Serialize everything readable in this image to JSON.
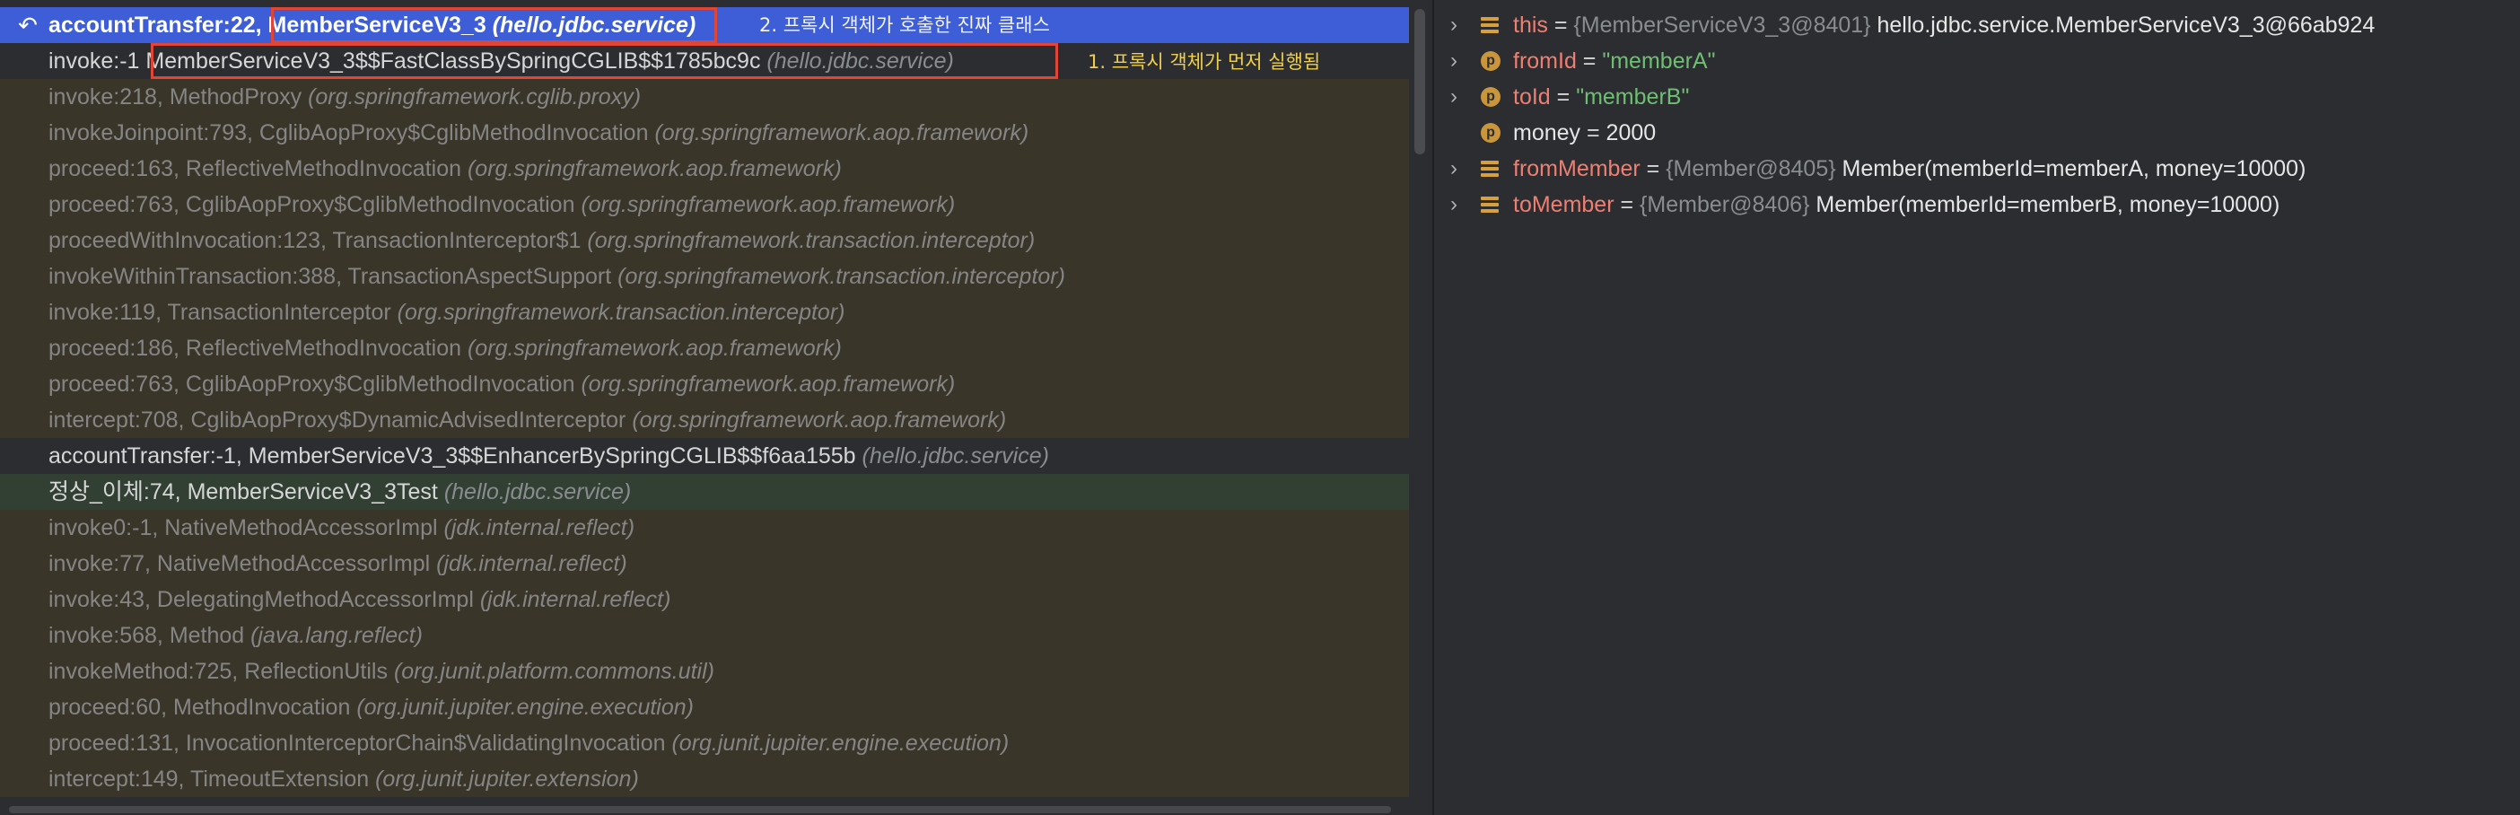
{
  "frames": [
    {
      "method": "accountTransfer:22, ",
      "cls": "MemberServiceV3_3",
      "pkg": "(hello.jdbc.service)",
      "kind": "selected"
    },
    {
      "method": "invoke:-1 ",
      "cls": "MemberServiceV3_3$$FastClassBySpringCGLIB$$1785bc9c",
      "pkg": "(hello.jdbc.service)",
      "kind": "user"
    },
    {
      "method": "invoke:218, ",
      "cls": "MethodProxy",
      "pkg": "(org.springframework.cglib.proxy)",
      "kind": "lib"
    },
    {
      "method": "invokeJoinpoint:793, ",
      "cls": "CglibAopProxy$CglibMethodInvocation",
      "pkg": "(org.springframework.aop.framework)",
      "kind": "lib"
    },
    {
      "method": "proceed:163, ",
      "cls": "ReflectiveMethodInvocation",
      "pkg": "(org.springframework.aop.framework)",
      "kind": "lib"
    },
    {
      "method": "proceed:763, ",
      "cls": "CglibAopProxy$CglibMethodInvocation",
      "pkg": "(org.springframework.aop.framework)",
      "kind": "lib"
    },
    {
      "method": "proceedWithInvocation:123, ",
      "cls": "TransactionInterceptor$1",
      "pkg": "(org.springframework.transaction.interceptor)",
      "kind": "lib"
    },
    {
      "method": "invokeWithinTransaction:388, ",
      "cls": "TransactionAspectSupport",
      "pkg": "(org.springframework.transaction.interceptor)",
      "kind": "lib"
    },
    {
      "method": "invoke:119, ",
      "cls": "TransactionInterceptor",
      "pkg": "(org.springframework.transaction.interceptor)",
      "kind": "lib"
    },
    {
      "method": "proceed:186, ",
      "cls": "ReflectiveMethodInvocation",
      "pkg": "(org.springframework.aop.framework)",
      "kind": "lib"
    },
    {
      "method": "proceed:763, ",
      "cls": "CglibAopProxy$CglibMethodInvocation",
      "pkg": "(org.springframework.aop.framework)",
      "kind": "lib"
    },
    {
      "method": "intercept:708, ",
      "cls": "CglibAopProxy$DynamicAdvisedInterceptor",
      "pkg": "(org.springframework.aop.framework)",
      "kind": "lib"
    },
    {
      "method": "accountTransfer:-1, ",
      "cls": "MemberServiceV3_3$$EnhancerBySpringCGLIB$$f6aa155b",
      "pkg": "(hello.jdbc.service)",
      "kind": "user"
    },
    {
      "method": "정상_이체:74, ",
      "cls": "MemberServiceV3_3Test",
      "pkg": "(hello.jdbc.service)",
      "kind": "test"
    },
    {
      "method": "invoke0:-1, ",
      "cls": "NativeMethodAccessorImpl",
      "pkg": "(jdk.internal.reflect)",
      "kind": "lib"
    },
    {
      "method": "invoke:77, ",
      "cls": "NativeMethodAccessorImpl",
      "pkg": "(jdk.internal.reflect)",
      "kind": "lib"
    },
    {
      "method": "invoke:43, ",
      "cls": "DelegatingMethodAccessorImpl",
      "pkg": "(jdk.internal.reflect)",
      "kind": "lib"
    },
    {
      "method": "invoke:568, ",
      "cls": "Method",
      "pkg": "(java.lang.reflect)",
      "kind": "lib"
    },
    {
      "method": "invokeMethod:725, ",
      "cls": "ReflectionUtils",
      "pkg": "(org.junit.platform.commons.util)",
      "kind": "lib"
    },
    {
      "method": "proceed:60, ",
      "cls": "MethodInvocation",
      "pkg": "(org.junit.jupiter.engine.execution)",
      "kind": "lib"
    },
    {
      "method": "proceed:131, ",
      "cls": "InvocationInterceptorChain$ValidatingInvocation",
      "pkg": "(org.junit.jupiter.engine.execution)",
      "kind": "lib"
    },
    {
      "method": "intercept:149, ",
      "cls": "TimeoutExtension",
      "pkg": "(org.junit.jupiter.extension)",
      "kind": "lib"
    }
  ],
  "annotations": {
    "real_class": "2. 프록시 객체가 호출한 진짜 클래스",
    "proxy_first": "1. 프록시 객체가 먼저 실행됨"
  },
  "variables": [
    {
      "name": "this",
      "ref": "{MemberServiceV3_3@8401}",
      "value": "hello.jdbc.service.MemberServiceV3_3@66ab924",
      "icon": "field-icon",
      "expandable": true
    },
    {
      "name": "fromId",
      "str": "\"memberA\"",
      "icon": "parameter-icon",
      "expandable": true
    },
    {
      "name": "toId",
      "str": "\"memberB\"",
      "icon": "parameter-icon",
      "expandable": true
    },
    {
      "name": "money",
      "num": "2000",
      "icon": "parameter-icon",
      "expandable": false
    },
    {
      "name": "fromMember",
      "ref": "{Member@8405}",
      "value": "Member(memberId=memberA, money=10000)",
      "icon": "field-icon",
      "expandable": true
    },
    {
      "name": "toMember",
      "ref": "{Member@8406}",
      "value": "Member(memberId=memberB, money=10000)",
      "icon": "field-icon",
      "expandable": true
    }
  ],
  "colors": {
    "selected_row": "#3d5ed6",
    "highlight_box": "#e04535",
    "annotation_yellow": "#f0d04a",
    "library_row": "#3a3529",
    "test_row": "#324034"
  }
}
